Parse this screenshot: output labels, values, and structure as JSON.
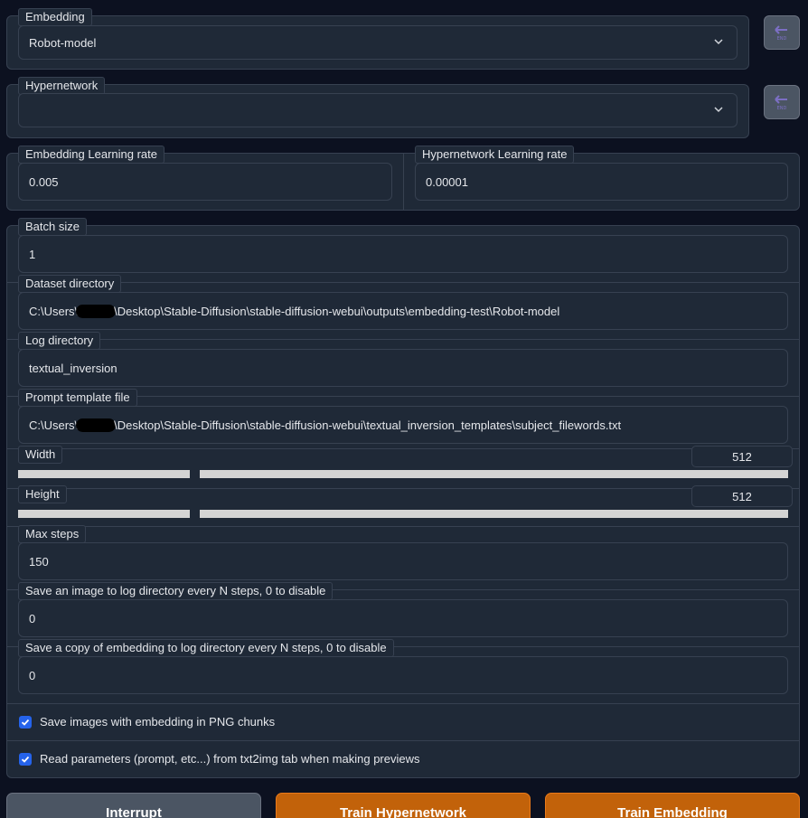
{
  "embedding": {
    "label": "Embedding",
    "value": "Robot-model"
  },
  "hypernetwork": {
    "label": "Hypernetwork",
    "value": ""
  },
  "rates": {
    "embedding_label": "Embedding Learning rate",
    "embedding_value": "0.005",
    "hypernetwork_label": "Hypernetwork Learning rate",
    "hypernetwork_value": "0.00001"
  },
  "batch_size": {
    "label": "Batch size",
    "value": "1"
  },
  "dataset_dir": {
    "label": "Dataset directory",
    "prefix": "C:\\Users\\",
    "suffix": "\\Desktop\\Stable-Diffusion\\stable-diffusion-webui\\outputs\\embedding-test\\Robot-model"
  },
  "log_dir": {
    "label": "Log directory",
    "value": "textual_inversion"
  },
  "prompt_template": {
    "label": "Prompt template file",
    "prefix": "C:\\Users\\",
    "suffix": "\\Desktop\\Stable-Diffusion\\stable-diffusion-webui\\textual_inversion_templates\\subject_filewords.txt"
  },
  "width": {
    "label": "Width",
    "value": "512"
  },
  "height": {
    "label": "Height",
    "value": "512"
  },
  "max_steps": {
    "label": "Max steps",
    "value": "150"
  },
  "save_image_every": {
    "label": "Save an image to log directory every N steps, 0 to disable",
    "value": "0"
  },
  "save_embedding_every": {
    "label": "Save a copy of embedding to log directory every N steps, 0 to disable",
    "value": "0"
  },
  "checkboxes": {
    "png_chunks": {
      "label": "Save images with embedding in PNG chunks",
      "checked": true
    },
    "read_params": {
      "label": "Read parameters (prompt, etc...) from txt2img tab when making previews",
      "checked": true
    }
  },
  "buttons": {
    "interrupt": "Interrupt",
    "train_hypernetwork": "Train Hypernetwork",
    "train_embedding": "Train Embedding"
  },
  "icons": {
    "refresh": "refresh-icon",
    "dropdown": "chevron-down-icon",
    "checkbox": "check-icon"
  },
  "colors": {
    "background": "#0c1120",
    "panel": "#1f2937",
    "border": "#374151",
    "accent_orange": "#c2620a",
    "checkbox_blue": "#2563eb",
    "slider_track": "#d4d4d4"
  }
}
